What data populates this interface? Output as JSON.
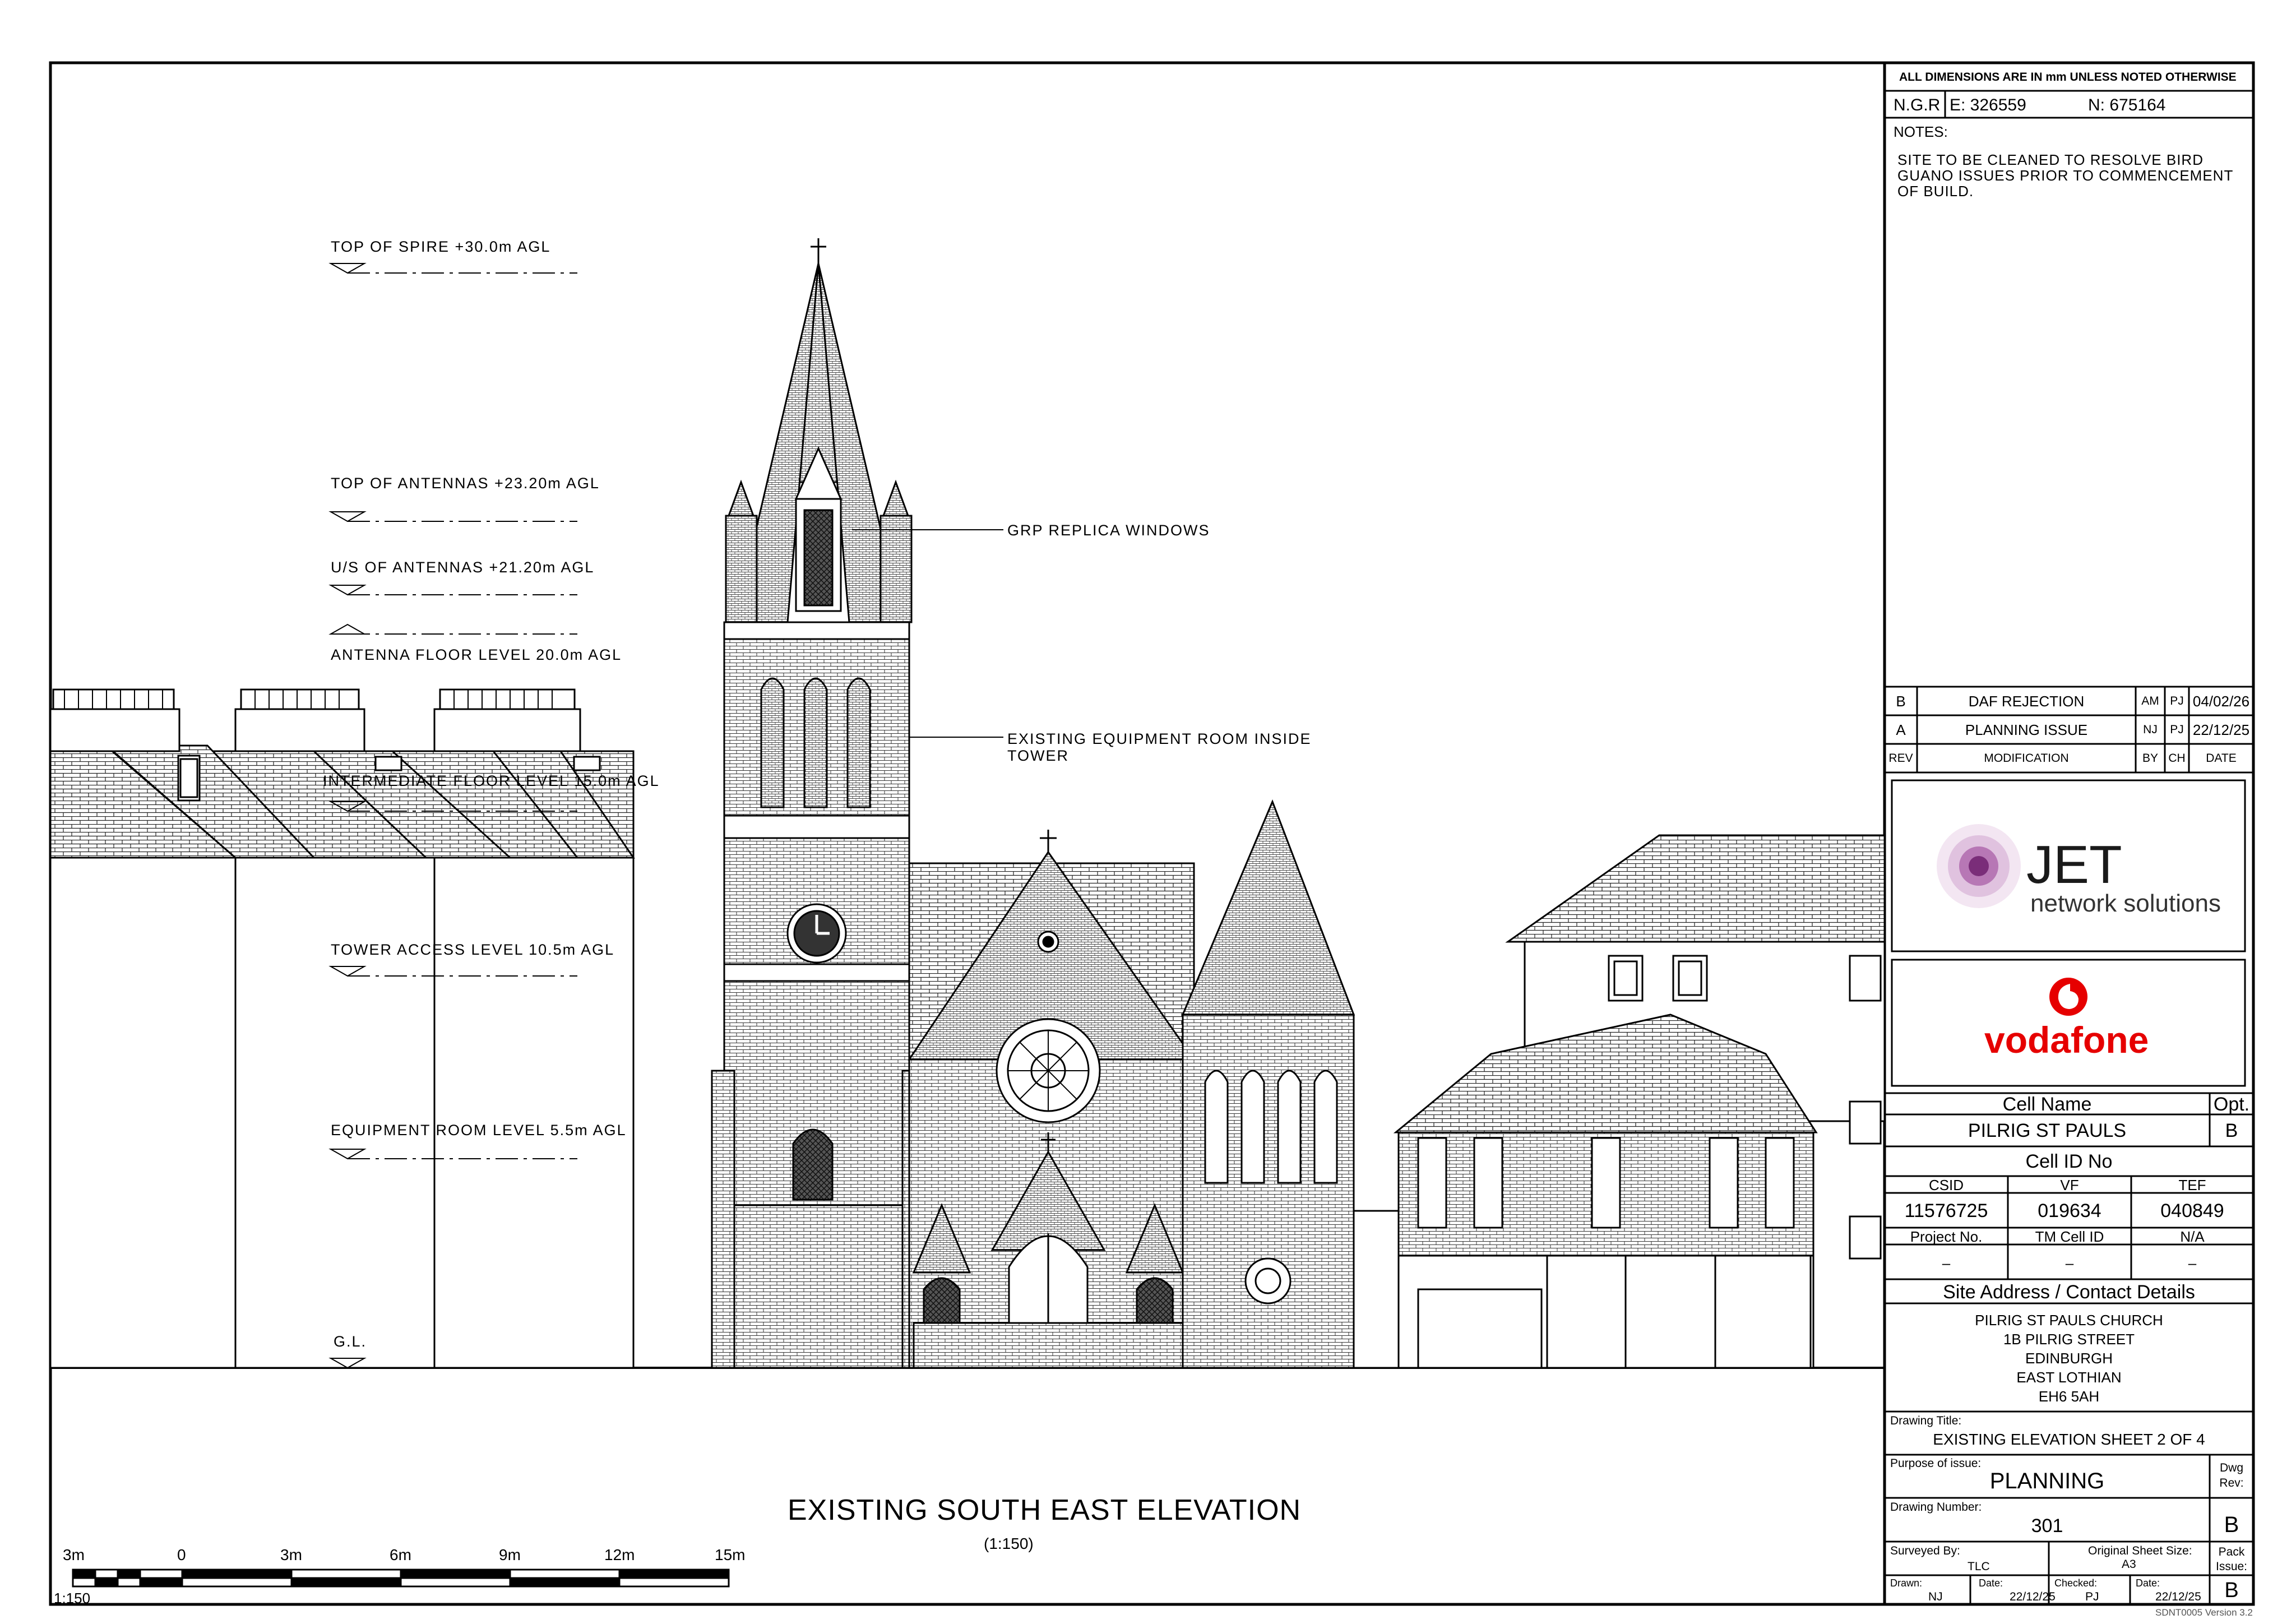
{
  "dimensions_note": "ALL DIMENSIONS ARE IN mm UNLESS NOTED OTHERWISE",
  "ngr": {
    "label": "N.G.R",
    "easting": "E: 326559",
    "northing": "N:  675164"
  },
  "notes": {
    "heading": "NOTES:",
    "lines": [
      "SITE TO BE CLEANED TO RESOLVE BIRD",
      "GUANO ISSUES PRIOR TO COMMENCEMENT",
      "OF BUILD."
    ]
  },
  "levels": [
    "TOP OF SPIRE +30.0m AGL",
    "TOP OF ANTENNAS +23.20m AGL",
    "U/S OF ANTENNAS +21.20m AGL",
    "ANTENNA FLOOR LEVEL 20.0m AGL",
    "INTERMEDIATE FLOOR LEVEL 15.0m AGL",
    "TOWER ACCESS LEVEL 10.5m AGL",
    "EQUIPMENT ROOM LEVEL 5.5m AGL",
    "G.L."
  ],
  "callouts": {
    "grp": "GRP REPLICA WINDOWS",
    "equipment_1": "EXISTING EQUIPMENT ROOM INSIDE",
    "equipment_2": "TOWER"
  },
  "drawing_caption": {
    "title": "EXISTING SOUTH EAST ELEVATION",
    "scale": "(1:150)"
  },
  "scale_bar": {
    "labels": [
      "3m",
      "0",
      "3m",
      "6m",
      "9m",
      "12m",
      "15m"
    ],
    "ratio": "1:150"
  },
  "revisions": {
    "rows": [
      {
        "rev": "B",
        "modification": "DAF REJECTION",
        "by": "AM",
        "ch": "PJ",
        "date": "04/02/26"
      },
      {
        "rev": "A",
        "modification": "PLANNING ISSUE",
        "by": "NJ",
        "ch": "PJ",
        "date": "22/12/25"
      }
    ],
    "header": {
      "rev": "REV",
      "modification": "MODIFICATION",
      "by": "BY",
      "ch": "CH",
      "date": "DATE"
    }
  },
  "logos": {
    "jet_main": "JET",
    "jet_sub": "network solutions",
    "vodafone": "vodafone"
  },
  "cell": {
    "name_label": "Cell Name",
    "opt_label": "Opt.",
    "name": "PILRIG ST PAULS",
    "opt": "B",
    "id_label": "Cell ID No",
    "csid_label": "CSID",
    "vf_label": "VF",
    "tef_label": "TEF",
    "csid": "11576725",
    "vf": "019634",
    "tef": "040849",
    "project_label": "Project No.",
    "tm_label": "TM Cell ID",
    "na": "N/A",
    "dash": "–"
  },
  "site": {
    "heading": "Site Address / Contact Details",
    "lines": [
      "PILRIG ST PAULS CHURCH",
      "1B PILRIG STREET",
      "EDINBURGH",
      "EAST LOTHIAN",
      "EH6 5AH"
    ]
  },
  "drawing_title": {
    "label": "Drawing Title:",
    "value": "EXISTING ELEVATION SHEET 2 OF 4"
  },
  "purpose": {
    "label": "Purpose of issue:",
    "value": "PLANNING",
    "dwg_rev_label_1": "Dwg",
    "dwg_rev_label_2": "Rev:"
  },
  "drawing_number": {
    "label": "Drawing Number:",
    "value": "301",
    "rev": "B"
  },
  "survey": {
    "surveyed_label": "Surveyed By:",
    "surveyed": "TLC",
    "sheet_label": "Original Sheet Size:",
    "sheet": "A3",
    "pack_1": "Pack",
    "pack_2": "Issue:"
  },
  "signoff": {
    "drawn_label": "Drawn:",
    "drawn": "NJ",
    "date_label": "Date:",
    "date": "22/12/25",
    "checked_label": "Checked:",
    "checked": "PJ",
    "date2_label": "Date:",
    "date2": "22/12/25",
    "pack_rev": "B"
  },
  "version": "SDNT0005 Version 3.2",
  "colors": {
    "jet_purple": "#7a2d79",
    "vodafone_red": "#e60000",
    "line": "#000000"
  }
}
